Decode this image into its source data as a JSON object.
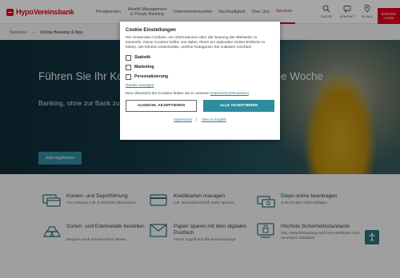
{
  "header": {
    "logo": "HypoVereinsbank",
    "nav": [
      {
        "label": "Privatkunden"
      },
      {
        "label": "Wealth Management & Private Banking"
      },
      {
        "label": "Unternehmerkunden"
      },
      {
        "label": "Nachhaltigkeit"
      },
      {
        "label": "Über Uns"
      },
      {
        "label": "Services"
      }
    ],
    "util": {
      "search": "SUCHE",
      "contact": "KONTAKT",
      "branch": "FILIALE"
    },
    "login": "BANKING LOGIN"
  },
  "breadcrumb": {
    "parent": "Services",
    "separator": "›",
    "current": "Online Banking & App"
  },
  "hero": {
    "title": "Führen Sie Ihr Konto flexibel online - an 7 Tagen die Woche",
    "subtitle": "Banking, ohne zur Bank zu müssen",
    "button": "Jetzt registrieren"
  },
  "features": [
    {
      "title": "Konten- und Depotführung",
      "desc": "Von zuhause z.B. in Echtzeit überweisen"
    },
    {
      "title": "Kreditkarten managen",
      "desc": "z.B. sekundenschnell Karte sperren"
    },
    {
      "title": "Dispo online beantragen",
      "desc": "Schnell über Geld verfügen"
    },
    {
      "title": "Sorten- und Edelmetalle bestellen",
      "desc": "Bequem nach Hause liefern lassen"
    },
    {
      "title": "Papier sparen mit dem digitalen Postfach",
      "desc": "Immer Zugriff auf alle Kontoauszüge"
    },
    {
      "title": "Höchste Sicherheitsstandards",
      "desc": "SSL-Verschlüsselung und TAN-Verfahren nach neuestem Standard"
    }
  ],
  "cookie": {
    "title": "Cookie Einstellungen",
    "text": "Wir verwenden Cookies, um Informationen über die Nutzung der Webseite zu sammeln. Diese Cookies helfen uns dabei, Ihnen ein optimales Online-Erlebnis zu bieten. Sie können entscheiden, welche Kategorien Sie zulassen möchten.",
    "categories": [
      {
        "label": "Statistik",
        "checked": false
      },
      {
        "label": "Marketing",
        "checked": false
      },
      {
        "label": "Personalisierung",
        "checked": false
      }
    ],
    "details": "Details anzeigen",
    "note_prefix": "Eine Übersicht der Cookies finden Sie in unseren ",
    "note_link": "Datenschutzhinweisen",
    "note_suffix": ".",
    "btn_selection": "AUSWAHL AKZEPTIEREN",
    "btn_all": "ALLE AKZEPTIEREN",
    "imprint": "Impressum",
    "divider": "|",
    "english": "View in English"
  },
  "colors": {
    "brand": "#e2001a",
    "accent": "#2f8c9e",
    "hero_dark": "#0e2b37"
  }
}
